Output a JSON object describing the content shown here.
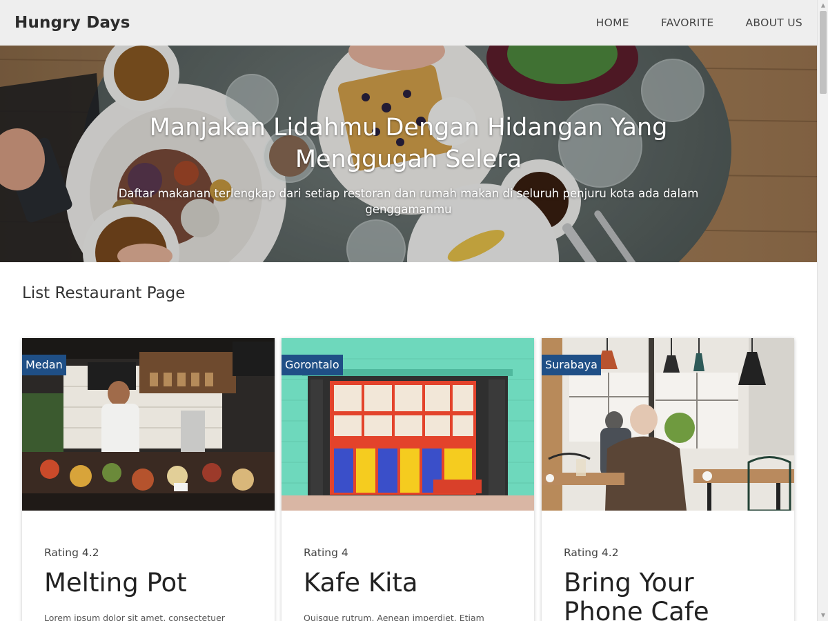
{
  "header": {
    "brand": "Hungry Days",
    "nav": [
      {
        "label": "HOME"
      },
      {
        "label": "FAVORITE"
      },
      {
        "label": "ABOUT US"
      }
    ]
  },
  "hero": {
    "title": "Manjakan Lidahmu Dengan Hidangan Yang Menggugah Selera",
    "subtitle": "Daftar makanan terlengkap dari setiap restoran dan rumah makan di seluruh penjuru kota ada dalam genggamanmu"
  },
  "main": {
    "section_title": "List Restaurant Page",
    "restaurants": [
      {
        "city": "Medan",
        "rating": "Rating 4.2",
        "name": "Melting Pot",
        "description": "Lorem ipsum dolor sit amet, consectetuer"
      },
      {
        "city": "Gorontalo",
        "rating": "Rating 4",
        "name": "Kafe Kita",
        "description": "Quisque rutrum. Aenean imperdiet. Etiam"
      },
      {
        "city": "Surabaya",
        "rating": "Rating 4.2",
        "name": "Bring Your Phone Cafe",
        "description": ""
      }
    ]
  },
  "colors": {
    "navbar_bg": "#eeeeee",
    "badge_bg": "#1f4f86",
    "page_bg": "#ffffff"
  }
}
